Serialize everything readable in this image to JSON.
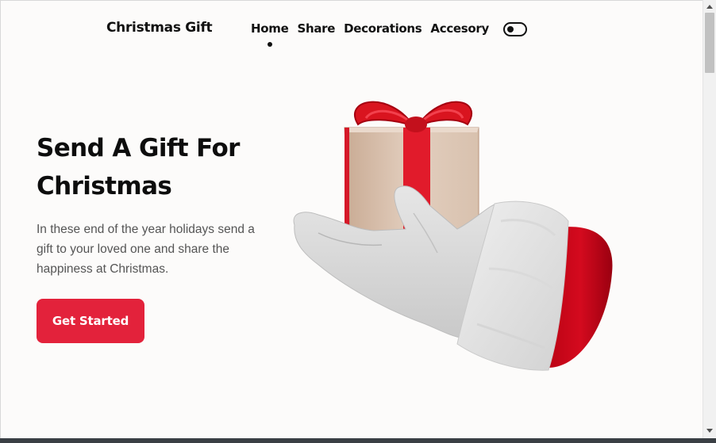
{
  "header": {
    "brand": "Christmas Gift",
    "nav": [
      {
        "label": "Home",
        "active": true
      },
      {
        "label": "Share",
        "active": false
      },
      {
        "label": "Decorations",
        "active": false
      },
      {
        "label": "Accesory",
        "active": false
      }
    ],
    "theme_toggle": {
      "icon": "toggle-icon",
      "state": "off"
    }
  },
  "hero": {
    "title": "Send A Gift For Christmas",
    "description": "In these end of the year holidays send a gift to your loved one and share the happiness at Christmas.",
    "cta_label": "Get Started",
    "image_subject": "santa-glove-holding-gift-image"
  },
  "colors": {
    "accent": "#e3223b",
    "background": "#fcfbfa",
    "text": "#0d0d0d",
    "muted_text": "#555555"
  }
}
